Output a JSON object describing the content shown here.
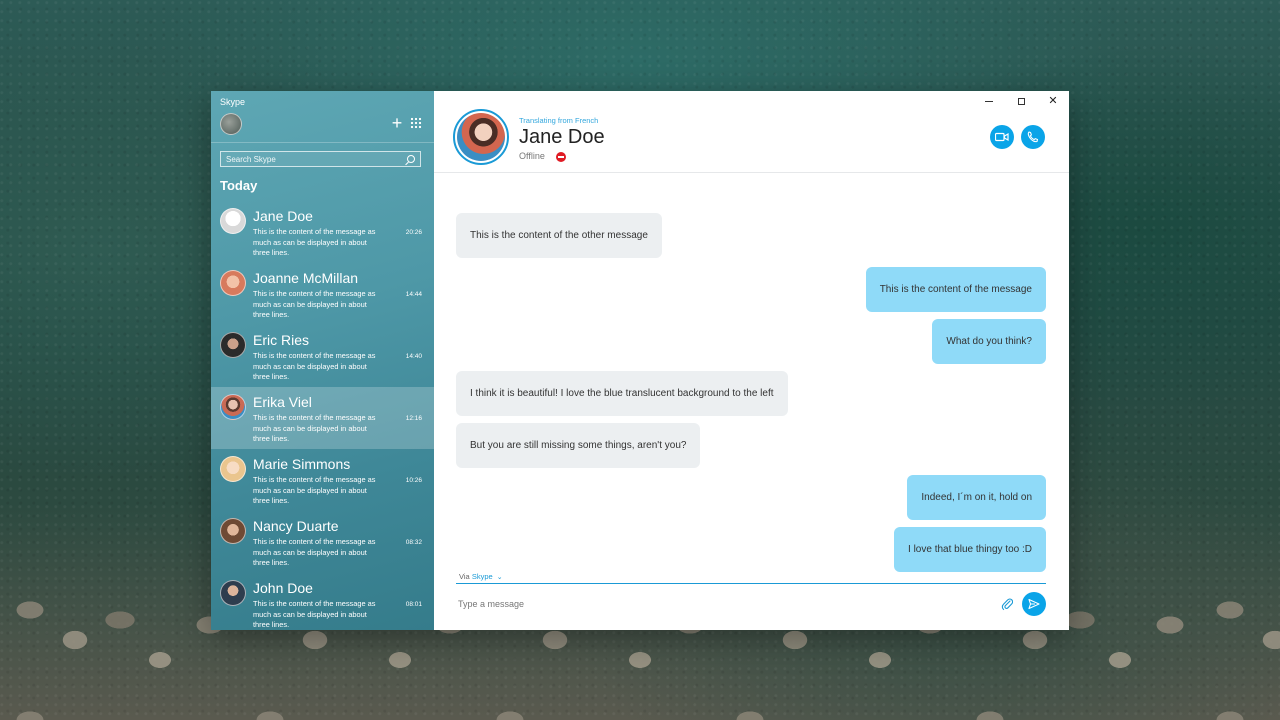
{
  "sidebar": {
    "app_title": "Skype",
    "search_placeholder": "Search Skype",
    "section_today": "Today",
    "conversations": [
      {
        "name": "Jane Doe",
        "preview": "This is the content of the message as much as can be displayed in about three lines.",
        "time": "20:26",
        "avatar_color": "#eeeeee"
      },
      {
        "name": "Joanne McMillan",
        "preview": "This is the content of the message as much as can be displayed in about three lines.",
        "time": "14:44",
        "avatar_color": "#e7a58a"
      },
      {
        "name": "Eric Ries",
        "preview": "This is the content of the message as much as can be displayed in about three lines.",
        "time": "14:40",
        "avatar_color": "#3a3a3a"
      },
      {
        "name": "Erika Viel",
        "preview": "This is the content of the message as much as can be displayed in about three lines.",
        "time": "12:16",
        "avatar_color": "#c96a55"
      },
      {
        "name": "Marie Simmons",
        "preview": "This is the content of the message as much as can be displayed in about three lines.",
        "time": "10:26",
        "avatar_color": "#f0c9a5"
      },
      {
        "name": "Nancy Duarte",
        "preview": "This is the content of the message as much as can be displayed in about three lines.",
        "time": "08:32",
        "avatar_color": "#b78a68"
      },
      {
        "name": "John Doe",
        "preview": "This is the content of the message as much as can be displayed in about three lines.",
        "time": "08:01",
        "avatar_color": "#2e3d4e"
      }
    ]
  },
  "chat": {
    "translating_label": "Translating from French",
    "contact_name": "Jane Doe",
    "contact_status": "Offline",
    "messages": [
      {
        "direction": "in",
        "text": "This is the content of the other message"
      },
      {
        "direction": "out",
        "text": "This is the content of the message"
      },
      {
        "direction": "out",
        "text": "What do you think?"
      },
      {
        "direction": "in",
        "text": "I think it is beautiful! I love the blue translucent background to the left"
      },
      {
        "direction": "in",
        "text": "But you are still missing some things, aren't you?"
      },
      {
        "direction": "out",
        "text": "Indeed, I´m on it, hold on"
      },
      {
        "direction": "out",
        "text": "I love that blue thingy too :D"
      }
    ],
    "via_prefix": "Via",
    "via_service": "Skype",
    "compose_placeholder": "Type a message"
  },
  "colors": {
    "accent": "#0aa4e8",
    "incoming_bubble": "#eceff1",
    "outgoing_bubble": "#8fdaf8",
    "offline": "#e01b24"
  }
}
